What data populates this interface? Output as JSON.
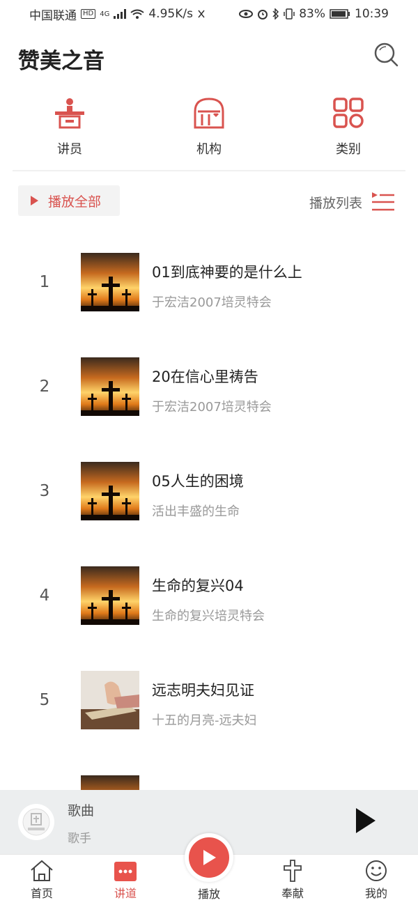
{
  "status_bar": {
    "carrier": "中国联通",
    "hd": "HD",
    "network": "4G",
    "speed": "4.95K/s",
    "battery": "83%",
    "time": "10:39"
  },
  "header": {
    "title": "赞美之音"
  },
  "categories": [
    {
      "label": "讲员",
      "icon": "speaker-podium-icon"
    },
    {
      "label": "机构",
      "icon": "building-icon"
    },
    {
      "label": "类别",
      "icon": "grid-icon"
    }
  ],
  "controls": {
    "play_all": "播放全部",
    "play_list": "播放列表"
  },
  "tracks": [
    {
      "num": "1",
      "title": "01到底神要的是什么上",
      "subtitle": "于宏洁2007培灵特会",
      "thumb": "cross-sunset"
    },
    {
      "num": "2",
      "title": "20在信心里祷告",
      "subtitle": "于宏洁2007培灵特会",
      "thumb": "cross-sunset"
    },
    {
      "num": "3",
      "title": "05人生的困境",
      "subtitle": "活出丰盛的生命",
      "thumb": "cross-sunset"
    },
    {
      "num": "4",
      "title": "生命的复兴04",
      "subtitle": "生命的复兴培灵特会",
      "thumb": "cross-sunset"
    },
    {
      "num": "5",
      "title": "远志明夫妇见证",
      "subtitle": "十五的月亮-远夫妇",
      "thumb": "praying-hands"
    }
  ],
  "mini_player": {
    "song": "歌曲",
    "artist": "歌手"
  },
  "tabs": [
    {
      "label": "首页",
      "icon": "home-icon"
    },
    {
      "label": "讲道",
      "icon": "sermon-icon"
    },
    {
      "label": "播放",
      "icon": "play-icon"
    },
    {
      "label": "奉献",
      "icon": "cross-icon"
    },
    {
      "label": "我的",
      "icon": "smiley-icon"
    }
  ],
  "colors": {
    "accent": "#d9534f",
    "play_button": "#e8534c",
    "mini_player_bg": "#eceeef"
  }
}
